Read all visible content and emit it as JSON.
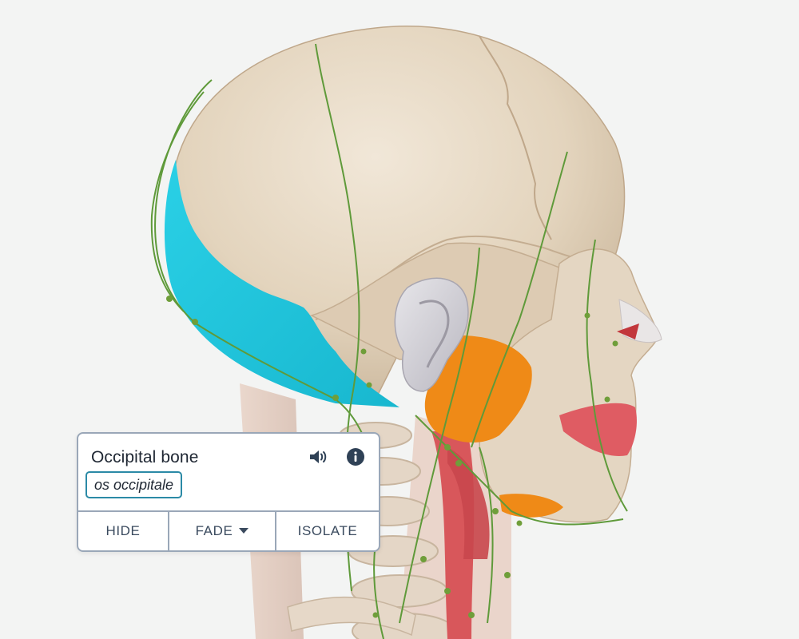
{
  "viewport": {
    "model": "head-skull-3d-model",
    "highlight_color": "#22c7de"
  },
  "info_card": {
    "title": "Occipital bone",
    "latin_name": "os occipitale",
    "icons": {
      "audio": "speaker-icon",
      "info": "info-icon",
      "dropdown": "caret-down-icon"
    },
    "actions": {
      "hide": "HIDE",
      "fade": "FADE",
      "isolate": "ISOLATE"
    }
  }
}
